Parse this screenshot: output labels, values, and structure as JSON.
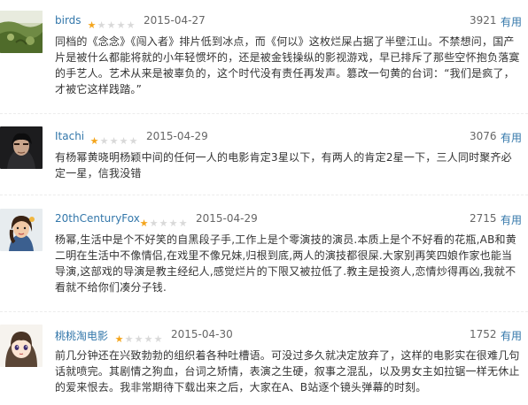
{
  "reviews": [
    {
      "user": "birds",
      "rating": 1,
      "date": "2015-04-27",
      "votes": "3921",
      "useful_label": "有用",
      "text": "同档的《念念》《闯入者》排片低到冰点，而《何以》这枚烂屎占据了半壁江山。不禁想问，国产片是被什么都能将就的小年轻惯坏的，还是被金钱操纵的影视游戏，早已排斥了那些空怀抱负落寞的手艺人。艺术从来是被辜负的，这个时代没有责任再发声。篡改一句黄的台词：“我们是疯了，才被它这样践踏。”"
    },
    {
      "user": "Itachi",
      "rating": 1,
      "date": "2015-04-29",
      "votes": "3076",
      "useful_label": "有用",
      "text": "有杨幂黄晓明杨颖中间的任何一人的电影肯定3星以下，有两人的肯定2星一下，三人同时聚齐必定一星，信我没错"
    },
    {
      "user": "20thCenturyFox",
      "rating": 1,
      "date": "2015-04-29",
      "votes": "2715",
      "useful_label": "有用",
      "text": "杨幂,生活中是个不好笑的自黑段子手,工作上是个零演技的演员.本质上是个不好看的花瓶,AB和黄二明在生活中不像情侣,在戏里不像兄妹,归根到底,两人的演技都很屎.大家别再笑四娘作家也能当导演,这部戏的导演是教主经纪人,感觉烂片的下限又被拉低了.教主是投资人,恋情炒得再凶,我就不看就不给你们凑分子钱."
    },
    {
      "user": "桃桃淘电影",
      "rating": 1,
      "date": "2015-04-30",
      "votes": "1752",
      "useful_label": "有用",
      "text": "前几分钟还在兴致勃勃的组织着各种吐槽语。可没过多久就决定放弃了，这样的电影实在很难几句话就喷完。其剧情之狗血，台词之矫情，表演之生硬，叙事之混乱，以及男女主如拉锯一样无休止的爱来恨去。我非常期待下载出来之后，大家在A、B站逐个镜头弹幕的时刻。"
    }
  ],
  "colors": {
    "link": "#3377aa",
    "star_on": "#f4a51c",
    "star_off": "#d9d9d9",
    "meta": "#666666",
    "text": "#333333"
  },
  "icons": {
    "star_filled": "star-filled-icon",
    "star_empty": "star-empty-icon"
  }
}
